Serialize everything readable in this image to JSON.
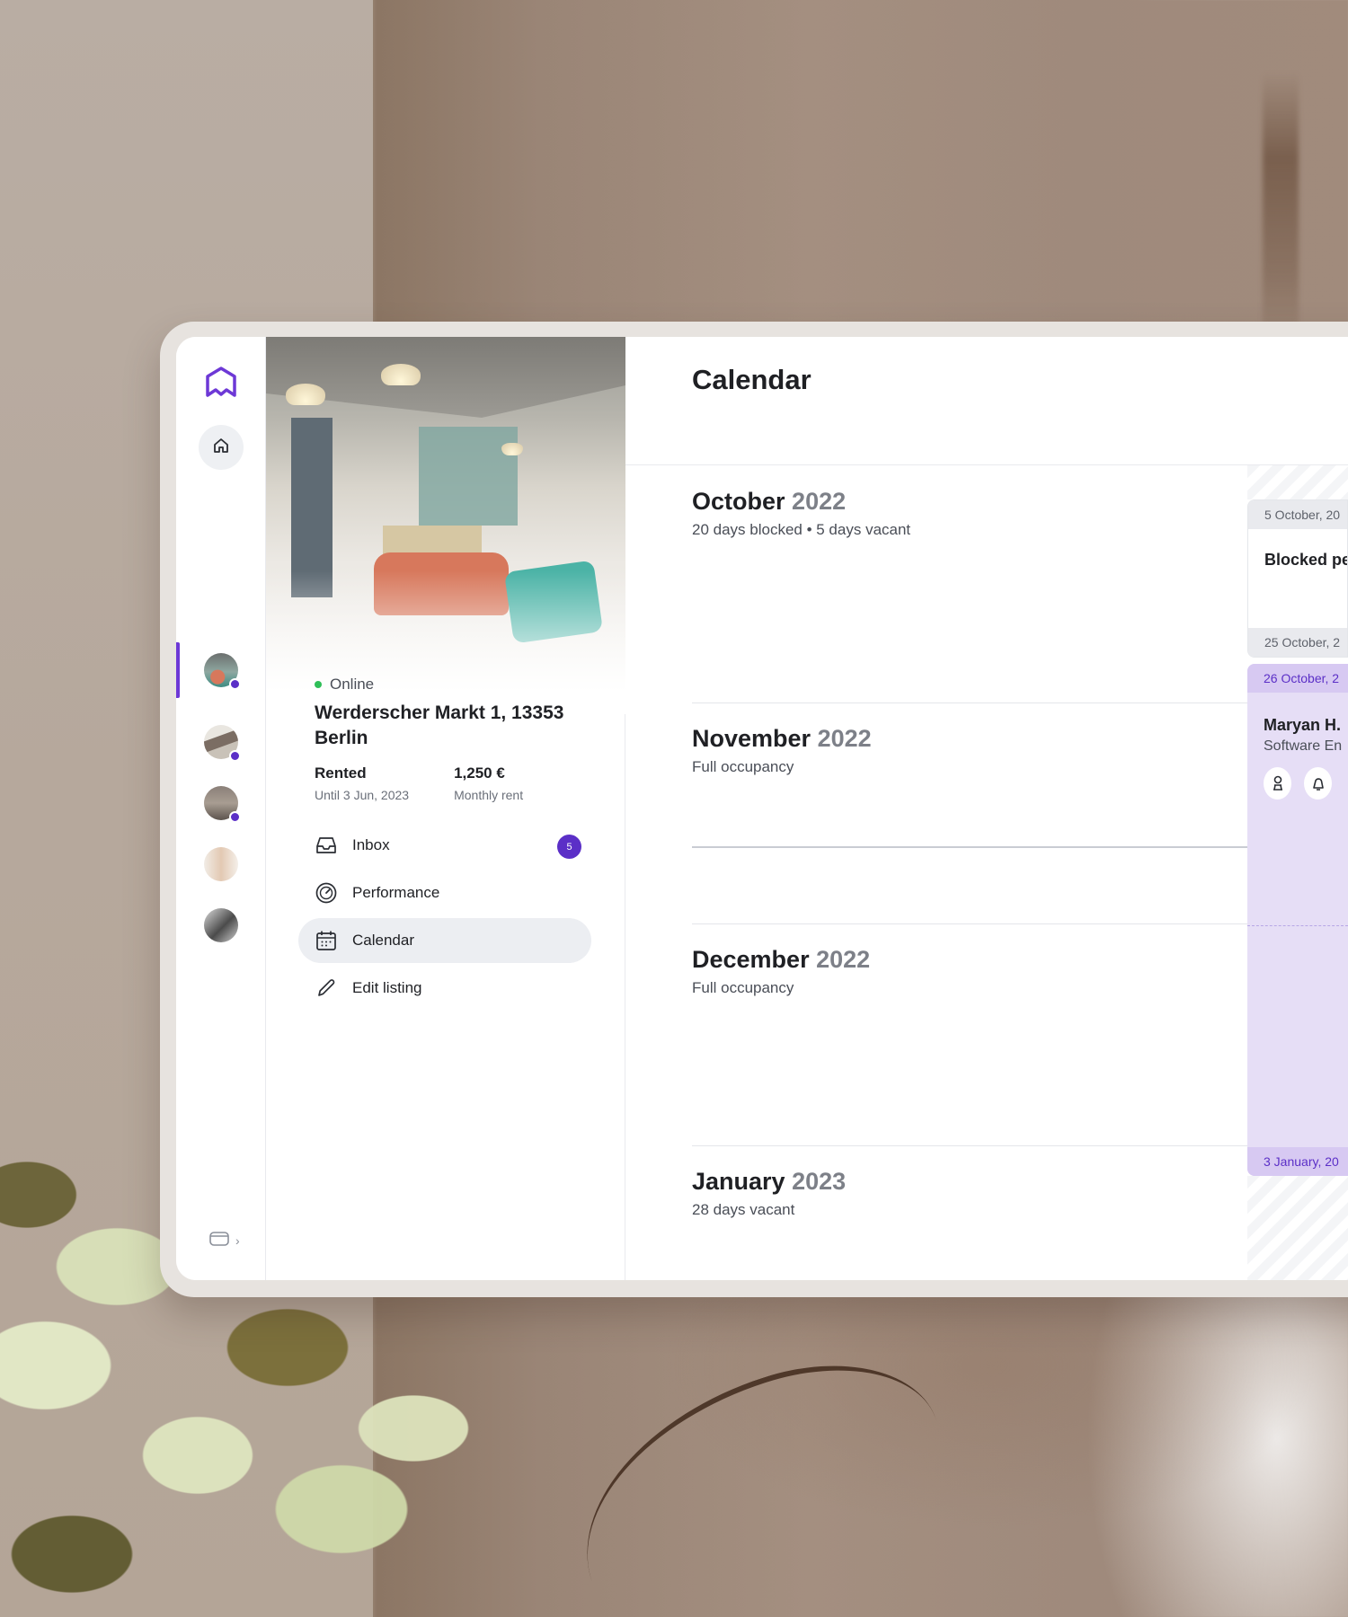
{
  "rail": {
    "logo_icon": "hexagon-logo-icon",
    "home_icon": "home-icon",
    "properties": [
      {
        "name": "property-1",
        "selected": true,
        "has_dot": true
      },
      {
        "name": "property-2",
        "selected": false,
        "has_dot": true
      },
      {
        "name": "property-3",
        "selected": false,
        "has_dot": true
      },
      {
        "name": "property-4",
        "selected": false,
        "has_dot": false
      },
      {
        "name": "property-5",
        "selected": false,
        "has_dot": false
      }
    ],
    "collapse_icon": "device-icon",
    "chevron": "›"
  },
  "property": {
    "status": "Online",
    "address": "Werderscher Markt 1, 13353 Berlin",
    "rented_label": "Rented",
    "rented_until": "Until 3 Jun, 2023",
    "rent_value": "1,250 €",
    "rent_label": "Monthly rent"
  },
  "menu": {
    "items": [
      {
        "label": "Inbox",
        "icon": "inbox-icon",
        "badge": "5",
        "active": false
      },
      {
        "label": "Performance",
        "icon": "gauge-icon",
        "badge": "",
        "active": false
      },
      {
        "label": "Calendar",
        "icon": "calendar-icon",
        "badge": "",
        "active": true
      },
      {
        "label": "Edit listing",
        "icon": "pencil-icon",
        "badge": "",
        "active": false
      }
    ]
  },
  "main": {
    "title": "Calendar",
    "months": [
      {
        "month": "October",
        "year": "2022",
        "summary": "20 days blocked • 5 days vacant"
      },
      {
        "month": "November",
        "year": "2022",
        "summary": "Full occupancy"
      },
      {
        "month": "December",
        "year": "2022",
        "summary": "Full occupancy"
      },
      {
        "month": "January",
        "year": "2023",
        "summary": "28 days vacant"
      }
    ]
  },
  "timeline": {
    "blocked": {
      "start": "5 October, 20",
      "title": "Blocked pe",
      "end": "25 October, 2"
    },
    "booking": {
      "start": "26 October, 2",
      "guest_name": "Maryan H.",
      "guest_role": "Software En",
      "icons": [
        "person-icon",
        "bell-icon"
      ],
      "end": "3 January, 20"
    }
  },
  "colors": {
    "accent": "#5b2fc7",
    "online": "#2fbf58",
    "booking_bg": "#e6def6",
    "booking_tag": "#d7c9f2",
    "blocked_tag": "#e9eaee"
  }
}
